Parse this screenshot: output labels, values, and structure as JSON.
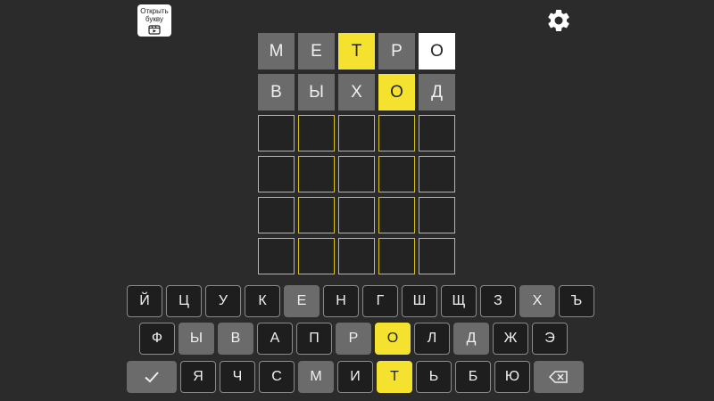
{
  "hint_button": {
    "label": "Открыть букву",
    "icon": "video-ad-icon"
  },
  "settings": {
    "icon": "gear-icon"
  },
  "board": {
    "rows": [
      [
        {
          "letter": "М",
          "state": "gray"
        },
        {
          "letter": "Е",
          "state": "gray"
        },
        {
          "letter": "Т",
          "state": "yellow"
        },
        {
          "letter": "Р",
          "state": "gray"
        },
        {
          "letter": "О",
          "state": "white"
        }
      ],
      [
        {
          "letter": "В",
          "state": "gray"
        },
        {
          "letter": "Ы",
          "state": "gray"
        },
        {
          "letter": "Х",
          "state": "gray"
        },
        {
          "letter": "О",
          "state": "yellow"
        },
        {
          "letter": "Д",
          "state": "gray"
        }
      ],
      [
        {
          "letter": "",
          "state": "empty"
        },
        {
          "letter": "",
          "state": "empty"
        },
        {
          "letter": "",
          "state": "empty"
        },
        {
          "letter": "",
          "state": "empty"
        },
        {
          "letter": "",
          "state": "empty"
        }
      ],
      [
        {
          "letter": "",
          "state": "empty"
        },
        {
          "letter": "",
          "state": "empty"
        },
        {
          "letter": "",
          "state": "empty"
        },
        {
          "letter": "",
          "state": "empty"
        },
        {
          "letter": "",
          "state": "empty"
        }
      ],
      [
        {
          "letter": "",
          "state": "empty"
        },
        {
          "letter": "",
          "state": "empty"
        },
        {
          "letter": "",
          "state": "empty"
        },
        {
          "letter": "",
          "state": "empty"
        },
        {
          "letter": "",
          "state": "empty"
        }
      ],
      [
        {
          "letter": "",
          "state": "empty"
        },
        {
          "letter": "",
          "state": "empty"
        },
        {
          "letter": "",
          "state": "empty"
        },
        {
          "letter": "",
          "state": "empty"
        },
        {
          "letter": "",
          "state": "empty"
        }
      ]
    ]
  },
  "keyboard": {
    "row1": [
      {
        "label": "Й",
        "state": "default"
      },
      {
        "label": "Ц",
        "state": "default"
      },
      {
        "label": "У",
        "state": "default"
      },
      {
        "label": "К",
        "state": "default"
      },
      {
        "label": "Е",
        "state": "gray"
      },
      {
        "label": "Н",
        "state": "default"
      },
      {
        "label": "Г",
        "state": "default"
      },
      {
        "label": "Ш",
        "state": "default"
      },
      {
        "label": "Щ",
        "state": "default"
      },
      {
        "label": "З",
        "state": "default"
      },
      {
        "label": "Х",
        "state": "gray"
      },
      {
        "label": "Ъ",
        "state": "default"
      }
    ],
    "row2": [
      {
        "label": "Ф",
        "state": "default"
      },
      {
        "label": "Ы",
        "state": "gray"
      },
      {
        "label": "В",
        "state": "gray"
      },
      {
        "label": "А",
        "state": "default"
      },
      {
        "label": "П",
        "state": "default"
      },
      {
        "label": "Р",
        "state": "gray"
      },
      {
        "label": "О",
        "state": "yellow"
      },
      {
        "label": "Л",
        "state": "default"
      },
      {
        "label": "Д",
        "state": "gray"
      },
      {
        "label": "Ж",
        "state": "default"
      },
      {
        "label": "Э",
        "state": "default"
      }
    ],
    "row3": [
      {
        "label": "Я",
        "state": "default"
      },
      {
        "label": "Ч",
        "state": "default"
      },
      {
        "label": "С",
        "state": "default"
      },
      {
        "label": "М",
        "state": "gray"
      },
      {
        "label": "И",
        "state": "default"
      },
      {
        "label": "Т",
        "state": "yellow"
      },
      {
        "label": "Ь",
        "state": "default"
      },
      {
        "label": "Б",
        "state": "default"
      },
      {
        "label": "Ю",
        "state": "default"
      }
    ],
    "enter_icon": "checkmark-icon",
    "backspace_icon": "backspace-icon"
  },
  "colors": {
    "background": "#2b2b2b",
    "gray": "#6b6b6b",
    "yellow": "#f4e22e",
    "empty_border": "#d8c21a"
  }
}
